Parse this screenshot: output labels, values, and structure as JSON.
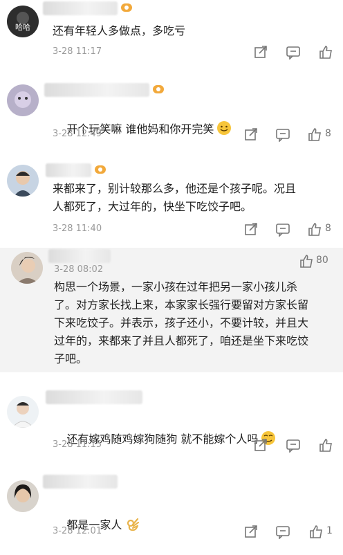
{
  "comments": [
    {
      "avatar_label": "哈哈",
      "text": "还有年轻人多做点，多吃亏",
      "time": "3-28 11:17",
      "likes": ""
    },
    {
      "text": "开个玩笑嘛 谁他妈和你开完笑",
      "time": "3-28 12:49",
      "likes": "8"
    },
    {
      "text": "来都来了，别计较那么多，他还是个孩子呢。况且\n人都死了，大过年的，快坐下吃饺子吧。",
      "time": "3-28 11:40",
      "likes": "8"
    },
    {
      "text": "构思一个场景，一家小孩在过年把另一家小孩儿杀\n了。对方家长找上来，本家家长强行要留对方家长留\n下来吃饺子。并表示，孩子还小，不要计较，并且大\n过年的，来都来了并且人都死了，咱还是坐下来吃饺\n子吧。",
      "time": "3-28 08:02",
      "likes": "80"
    },
    {
      "text": "还有嫁鸡随鸡嫁狗随狗 就不能嫁个人吗",
      "time": "3-28 11:15",
      "likes": ""
    },
    {
      "text": "都是一家人",
      "time": "3-28 12:01",
      "likes": "1"
    }
  ],
  "icons": {
    "share": "share-icon",
    "comment": "comment-icon",
    "like": "like-icon"
  },
  "colors": {
    "text": "#1f1f1f",
    "meta": "#9a9a9a",
    "highlight_bg": "#f3f3f3"
  }
}
